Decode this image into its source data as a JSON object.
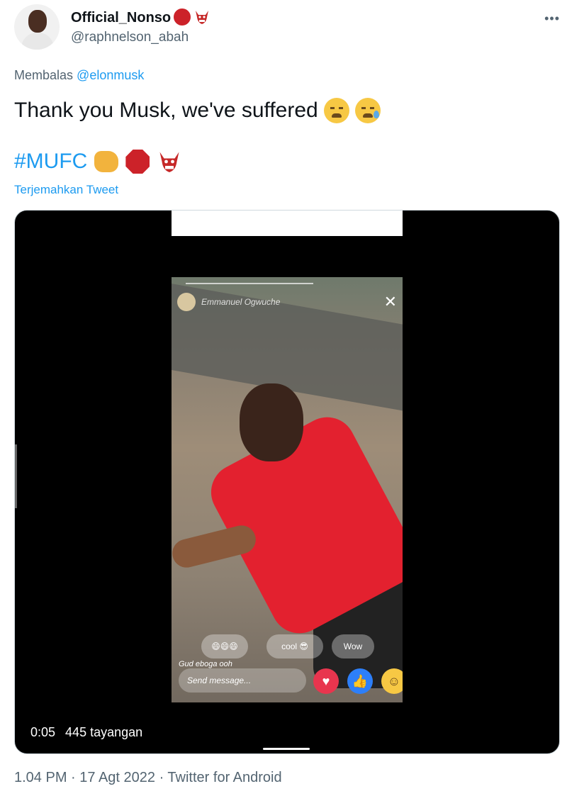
{
  "user": {
    "display_name": "Official_Nonso",
    "handle": "@raphnelson_abah"
  },
  "reply": {
    "prefix": "Membalas",
    "mention": "@elonmusk"
  },
  "tweet": {
    "line1": "Thank you Musk, we've suffered",
    "hashtag": "#MUFC",
    "translate_link": "Terjemahkan Tweet"
  },
  "video": {
    "time": "0:05",
    "views": "445 tayangan",
    "frame": {
      "live_name": "Emmanuel Ogwuche",
      "chip_1": "😄😄😄",
      "chip_2": "cool 😎",
      "chip_3": "Wow",
      "comment_user": "Gud eboga ooh",
      "comment_placeholder": "Send message..."
    }
  },
  "footer": {
    "timestamp": "1.04 PM · 17 Agt 2022 · Twitter for Android"
  },
  "colors": {
    "link": "#1d9bf0",
    "secondary_text": "#536471",
    "primary_text": "#0f1419"
  },
  "icons": {
    "more": "more-icon",
    "stop": "stop-sign-icon",
    "devil": "ogre-icon",
    "fist": "fist-icon"
  }
}
